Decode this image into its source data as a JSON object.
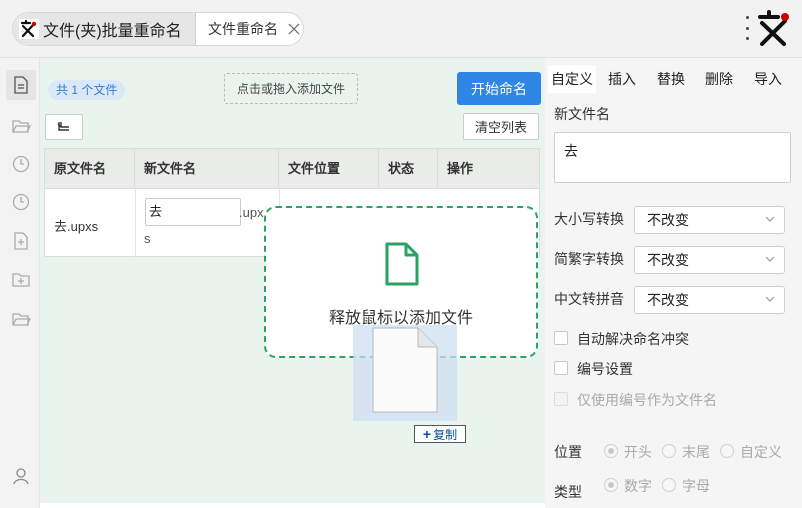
{
  "titlebar": {
    "tab_main": "文件(夹)批量重命名",
    "tab_secondary": "文件重命名"
  },
  "nav": {
    "icons": [
      "file-icon",
      "folder-open-icon",
      "clock-icon",
      "clock-icon",
      "file-add-icon",
      "folder-add-icon",
      "folder-icon",
      "user-icon"
    ]
  },
  "toolbar": {
    "file_count": "共 1 个文件",
    "drop_hint": "点击或拖入添加文件",
    "start_label": "开始命名",
    "clear_label": "清空列表"
  },
  "table": {
    "columns": [
      "原文件名",
      "新文件名",
      "文件位置",
      "状态",
      "操作"
    ],
    "rows": [
      {
        "original": "去.upxs",
        "new_name_value": "去",
        "ext": ".upx",
        "ext_wrap": "s"
      }
    ]
  },
  "overlay": {
    "drop_message": "释放鼠标以添加文件",
    "copy_label": "复制"
  },
  "right_panel": {
    "tabs": [
      "自定义",
      "插入",
      "替换",
      "删除",
      "导入"
    ],
    "active_tab": "自定义",
    "new_name_label": "新文件名",
    "new_name_value": "去",
    "case_label": "大小写转换",
    "case_value": "不改变",
    "trad_label": "简繁字转换",
    "trad_value": "不改变",
    "pinyin_label": "中文转拼音",
    "pinyin_value": "不改变",
    "auto_resolve_label": "自动解决命名冲突",
    "number_settings_label": "编号设置",
    "number_only_label": "仅使用编号作为文件名",
    "position_label": "位置",
    "position_options": [
      "开头",
      "末尾",
      "自定义"
    ],
    "type_label": "类型",
    "type_options": [
      "数字",
      "字母"
    ]
  },
  "colors": {
    "accent": "#2f86e4",
    "drop_border": "#2aa362",
    "main_bg": "#eaf4ee"
  }
}
